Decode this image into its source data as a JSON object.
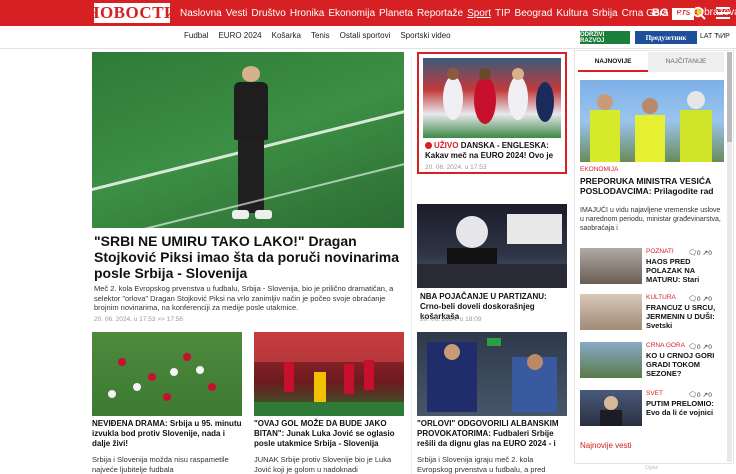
{
  "header": {
    "logo": "НОВОСТИ",
    "nav": [
      "Naslovna",
      "Vesti",
      "Društvo",
      "Hronika",
      "Ekonomija",
      "Planeta",
      "Reportaže",
      "Sport",
      "TIP",
      "Beograd",
      "Kultura",
      "Srbija",
      "Crna Gora"
    ],
    "rts_label": "RTS",
    "nav_last": "Obrazovanje",
    "weather": "BG 32 °"
  },
  "subnav": [
    "Fudbal",
    "EURO 2024",
    "Košarka",
    "Tenis",
    "Ostali sportovi",
    "Sportski video"
  ],
  "buttons": {
    "green": "ODRŽIVI RAZVOJ",
    "blue": "Предузетник",
    "lat": "LAT ЋИР"
  },
  "main": {
    "title": "\"SRBI NE UMIRU TAKO LAKO!\" Dragan Stojković Piksi imao šta da poruči novinarima posle Srbija - Slovenija",
    "lead": "Meč 2. kola Evropskog prvenstva u fudbalu, Srbija - Slovenija, bio je prilično dramatičan, a selektor \"orlova\" Dragan Stojković Piksi na vrlo zanimljiv način je počeo svoje obraćanje brojnim novinarima, na konferenciji za medije posle utakmice.",
    "date": "20. 06. 2024. u 17:53 >> 17:56"
  },
  "live": {
    "badge": "UŽIVO",
    "title": "DANSKA - ENGLESKA: Kakav meč na EURO 2024! Ovo je",
    "date": "20. 06. 2024. u 17:53"
  },
  "partizan": {
    "title": "NBA POJAČANJE U PARTIZANU: Crno-beli doveli doskorašnjeg košarkaša",
    "date": "20. 06. 2024. u 18:09"
  },
  "bottom": [
    {
      "title": "NEVIĐENA DRAMA: Srbija u 95. minutu izvukla bod protiv Slovenije, nada i dalje živi!",
      "text": "Srbija i Slovenija možda nisu raspametile najveće ljubitelje fudbala"
    },
    {
      "title": "\"OVAJ GOL MOŽE DA BUDE JAKO BITAN\": Junak Luka Jović se oglasio posle utakmice Srbija - Slovenija",
      "text": "JUNAK Srbije protiv Slovenije bio je Luka Jović koji je golom u nadoknadi"
    },
    {
      "title": "\"ORLOVI\" ODGOVORILI ALBANSKIM PROVOKATORIMA: Fudbaleri Srbije rešili da dignu glas na EURO 2024 - i",
      "text": "Srbija i Slovenija igraju meč 2. kola Evropskog prvenstva u fudbalu, a pred"
    }
  ],
  "sidebar": {
    "tab_new": "NAJNOVIJE",
    "tab_read": "NAJČITANIJE",
    "top": {
      "category": "EKONOMIJA",
      "title": "PREPORUKA MINISTRA VESIĆA POSLODAVCIMA: Prilagodite rad",
      "text": "IMAJUĆI u vidu najavljene vremenske uslove u narednom periodu, ministar građevinarstva, saobraćaja i"
    },
    "items": [
      {
        "category": "POZNATI",
        "title": "HAOS PRED POLAZAK NA MATURU: Stari",
        "comments": "0",
        "shares": "0"
      },
      {
        "category": "KULTURA",
        "title": "FRANCUZ U SRCU, JERMENIN U DUŠI: Svetski",
        "comments": "0",
        "shares": "0"
      },
      {
        "category": "CRNA GORA",
        "title": "KO U CRNOJ GORI GRADI TOKOM SEZONE?",
        "comments": "0",
        "shares": "0"
      },
      {
        "category": "SVET",
        "title": "PUTIM PRELOMIO: Evo da li će vojnici",
        "comments": "0",
        "shares": "0"
      }
    ],
    "all_news": "Najnovije vesti",
    "ad_label": "Oglas"
  },
  "colors": {
    "brand": "#d62024",
    "green": "#1b7e3b",
    "blue": "#1d4f9a"
  }
}
